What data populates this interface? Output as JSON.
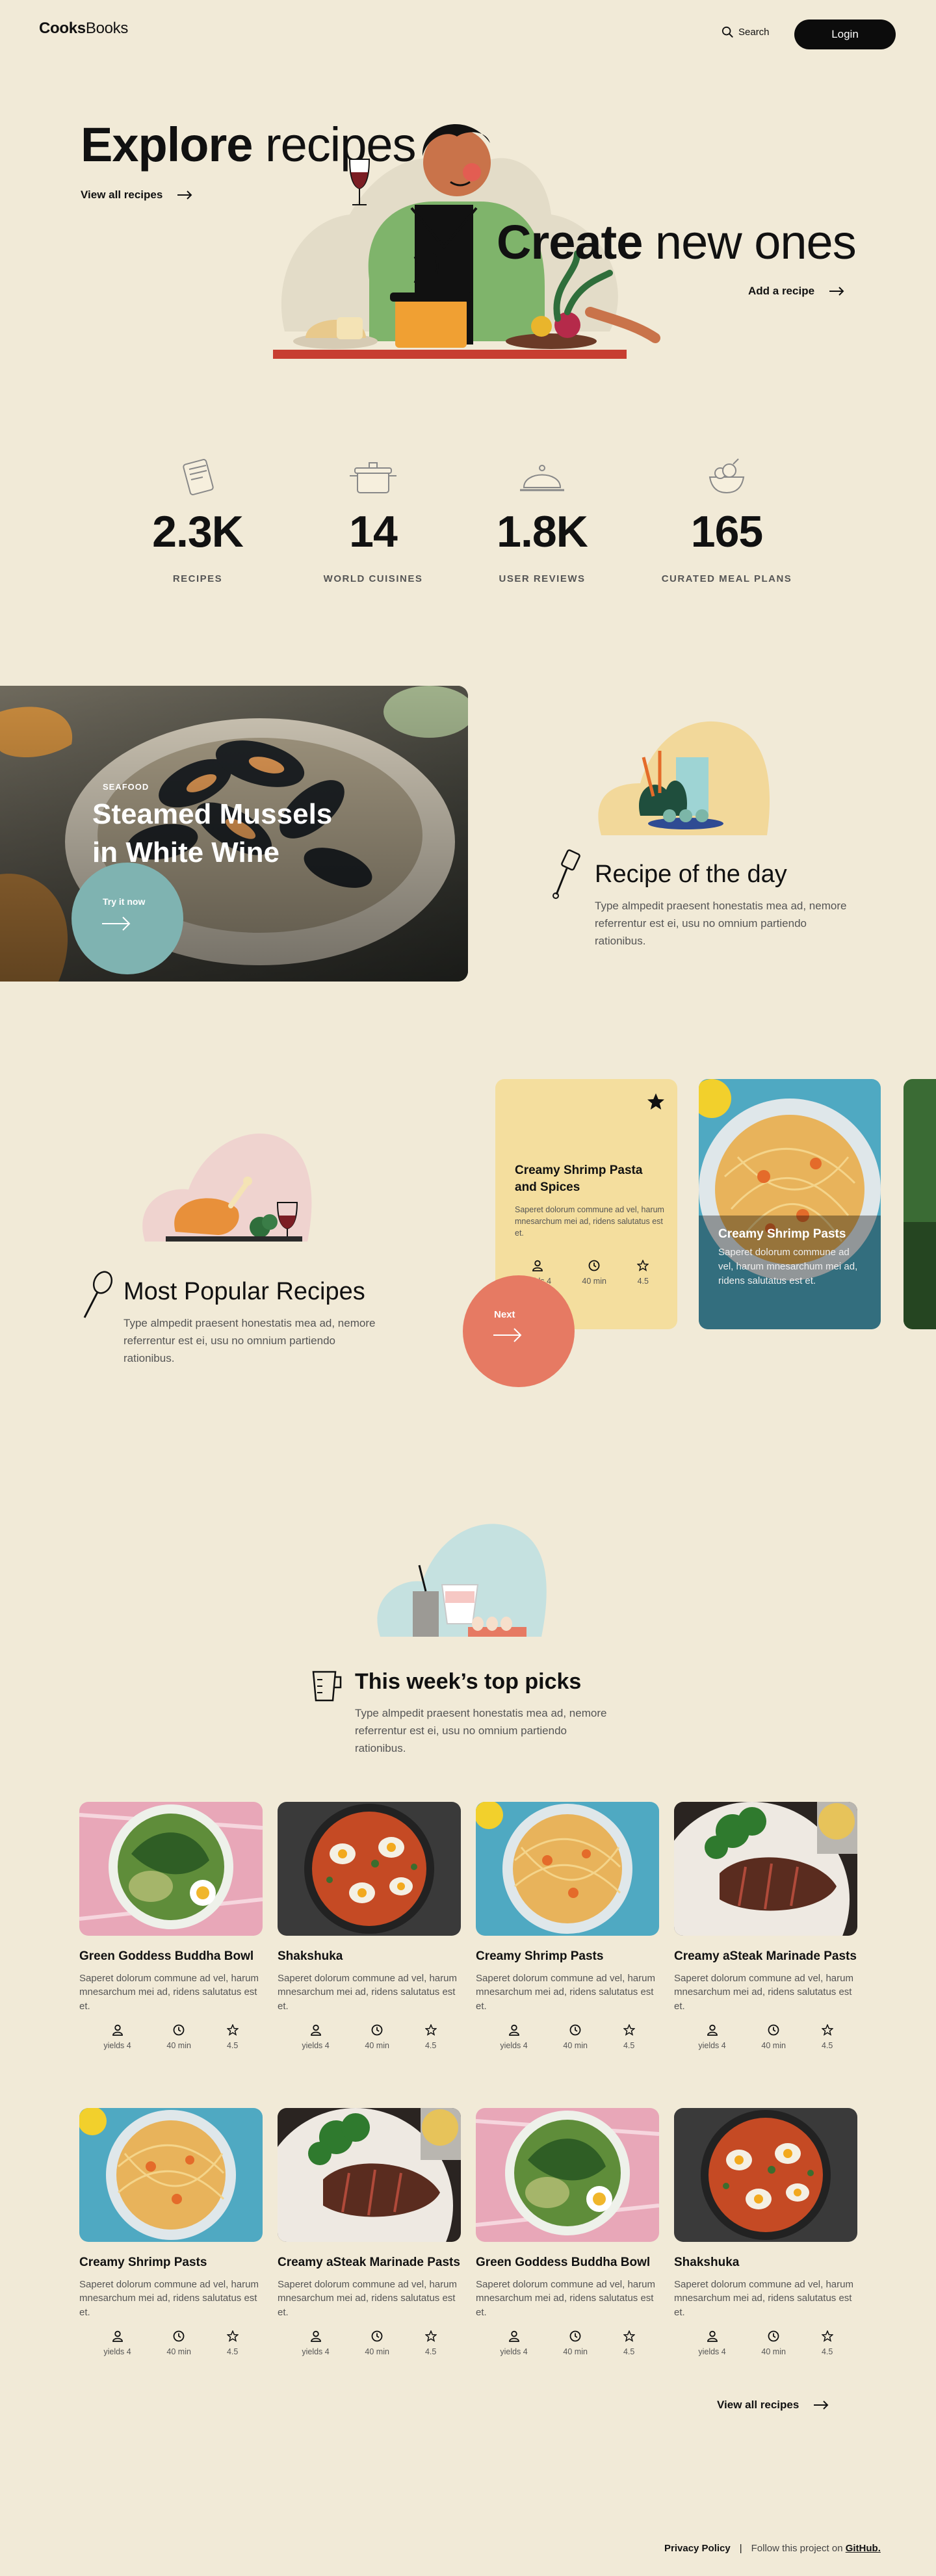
{
  "header": {
    "logo_bold": "Cooks",
    "logo_light": "Books",
    "search_label": "Search",
    "login_label": "Login"
  },
  "hero": {
    "explore_bold": "Explore",
    "explore_light": "recipes",
    "view_all": "View all recipes",
    "create_bold": "Create",
    "create_light": "new ones",
    "add_recipe": "Add a recipe"
  },
  "stats": [
    {
      "value": "2.3K",
      "label": "RECIPES",
      "icon": "book-icon"
    },
    {
      "value": "14",
      "label": "WORLD CUISINES",
      "icon": "pot-icon"
    },
    {
      "value": "1.8K",
      "label": "USER REVIEWS",
      "icon": "cloche-icon"
    },
    {
      "value": "165",
      "label": "CURATED MEAL PLANS",
      "icon": "bowl-icon"
    }
  ],
  "feature": {
    "tag": "SEAFOOD",
    "title_line1": "Steamed Mussels",
    "title_line2": "in White Wine",
    "cta": "Try it now"
  },
  "recipe_of_day": {
    "title": "Recipe of the day",
    "desc": "Type almpedit praesent honestatis mea ad, nemore referrentur est ei, usu no omnium partiendo rationibus."
  },
  "popular": {
    "title": "Most Popular Recipes",
    "desc": "Type almpedit praesent honestatis mea ad, nemore referrentur est ei, usu no omnium partiendo rationibus.",
    "next_label": "Next",
    "card1": {
      "title": "Creamy Shrimp Pasta and Spices",
      "desc": "Saperet dolorum commune ad vel, harum mnesarchum mei ad, ridens salutatus est et.",
      "yields": "yields 4",
      "time": "40 min",
      "rating": "4.5"
    },
    "card2": {
      "title": "Creamy Shrimp Pasts",
      "desc": "Saperet dolorum commune ad vel, harum mnesarchum mei ad, ridens salutatus est et."
    }
  },
  "top_picks": {
    "title": "This week’s top picks",
    "desc": "Type almpedit praesent honestatis mea ad, nemore referrentur est ei, usu no omnium partiendo rationibus.",
    "view_all": "View all recipes",
    "cards": [
      {
        "name": "Green Goddess Buddha Bowl",
        "desc": "Saperet dolorum commune ad vel, harum mnesarchum mei ad, ridens salutatus est et.",
        "yields": "yields 4",
        "time": "40 min",
        "rating": "4.5",
        "img": "bowl"
      },
      {
        "name": "Shakshuka",
        "desc": "Saperet dolorum commune ad vel, harum mnesarchum mei ad, ridens salutatus est et.",
        "yields": "yields 4",
        "time": "40 min",
        "rating": "4.5",
        "img": "shakshuka"
      },
      {
        "name": "Creamy Shrimp Pasts",
        "desc": "Saperet dolorum commune ad vel, harum mnesarchum mei ad, ridens salutatus est et.",
        "yields": "yields 4",
        "time": "40 min",
        "rating": "4.5",
        "img": "pasta"
      },
      {
        "name": "Creamy aSteak Marinade Pasts",
        "desc": "Saperet dolorum commune ad vel, harum mnesarchum mei ad, ridens salutatus est et.",
        "yields": "yields 4",
        "time": "40 min",
        "rating": "4.5",
        "img": "steak"
      },
      {
        "name": "Creamy Shrimp Pasts",
        "desc": "Saperet dolorum commune ad vel, harum mnesarchum mei ad, ridens salutatus est et.",
        "yields": "yields 4",
        "time": "40 min",
        "rating": "4.5",
        "img": "pasta"
      },
      {
        "name": "Creamy aSteak Marinade Pasts",
        "desc": "Saperet dolorum commune ad vel, harum mnesarchum mei ad, ridens salutatus est et.",
        "yields": "yields 4",
        "time": "40 min",
        "rating": "4.5",
        "img": "steak"
      },
      {
        "name": "Green Goddess Buddha Bowl",
        "desc": "Saperet dolorum commune ad vel, harum mnesarchum mei ad, ridens salutatus est et.",
        "yields": "yields 4",
        "time": "40 min",
        "rating": "4.5",
        "img": "bowl"
      },
      {
        "name": "Shakshuka",
        "desc": "Saperet dolorum commune ad vel, harum mnesarchum mei ad, ridens salutatus est et.",
        "yields": "yields 4",
        "time": "40 min",
        "rating": "4.5",
        "img": "shakshuka"
      }
    ]
  },
  "footer": {
    "privacy": "Privacy Policy",
    "separator": "|",
    "follow": "Follow this project on",
    "github": "GitHub."
  },
  "colors": {
    "background": "#F1EAD7",
    "teal": "#7FB3B1",
    "coral": "#E67A63",
    "yellow_card": "#F4DE9E",
    "dark": "#0c0c0c"
  }
}
